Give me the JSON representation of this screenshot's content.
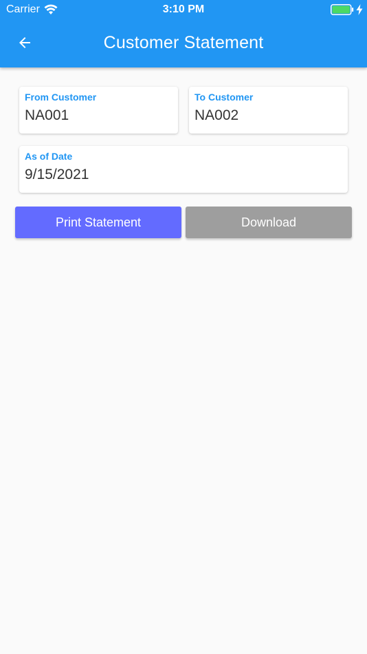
{
  "status_bar": {
    "carrier": "Carrier",
    "time": "3:10 PM",
    "battery_color": "#4cd964"
  },
  "header": {
    "title": "Customer Statement",
    "background_color": "#2196f3"
  },
  "form": {
    "from_customer": {
      "label": "From Customer",
      "value": "NA001"
    },
    "to_customer": {
      "label": "To Customer",
      "value": "NA002"
    },
    "as_of_date": {
      "label": "As of Date",
      "value": "9/15/2021"
    }
  },
  "actions": {
    "print_label": "Print Statement",
    "print_color": "#636bff",
    "download_label": "Download",
    "download_color": "#9e9e9e"
  }
}
